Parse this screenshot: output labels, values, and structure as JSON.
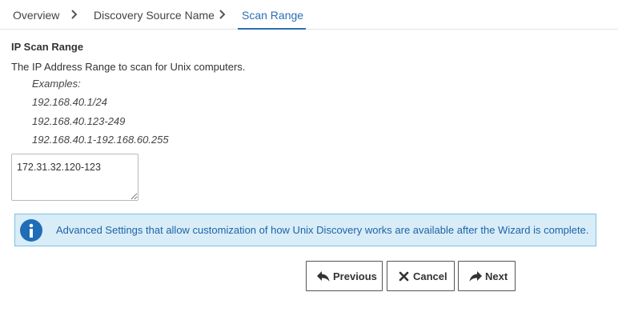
{
  "breadcrumb": {
    "items": [
      {
        "label": "Overview"
      },
      {
        "label": "Discovery Source Name"
      },
      {
        "label": "Scan Range"
      }
    ],
    "active_index": 2
  },
  "section": {
    "title": "IP Scan Range",
    "description": "The IP Address Range to scan for Unix computers.",
    "examples_heading": "Examples:",
    "examples": [
      "192.168.40.1/24",
      "192.168.40.123-249",
      "192.168.40.1-192.168.60.255"
    ]
  },
  "range_input": {
    "value": "172.31.32.120-123"
  },
  "info": {
    "icon": "info-icon",
    "text": "Advanced Settings that allow customization of how Unix Discovery works are available after the Wizard is complete."
  },
  "buttons": {
    "previous": "Previous",
    "cancel": "Cancel",
    "next": "Next"
  },
  "colors": {
    "accent": "#2c6fb5",
    "info_bg": "#d8edf8",
    "info_border": "#7fbfe2",
    "info_icon": "#1f6db6"
  }
}
